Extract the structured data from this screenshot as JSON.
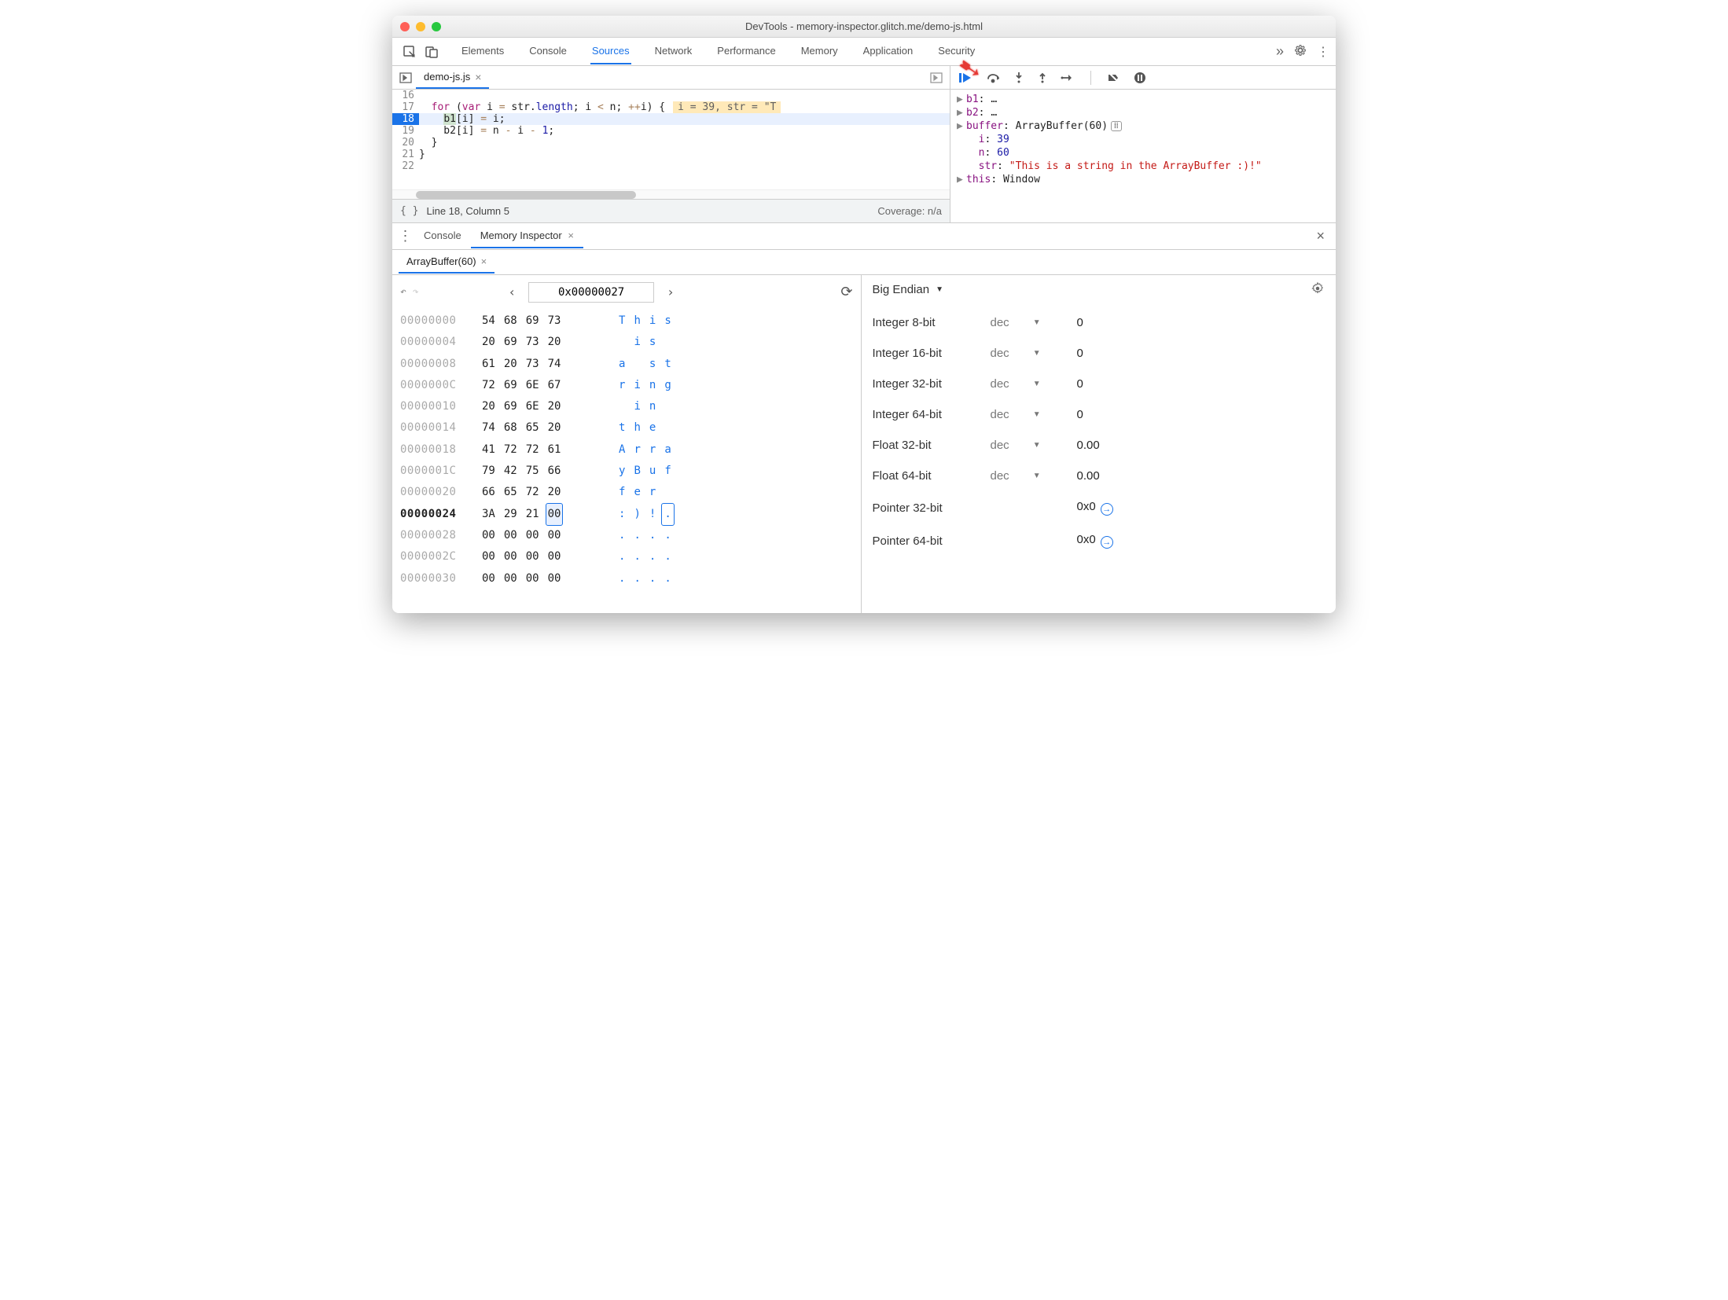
{
  "window": {
    "title": "DevTools - memory-inspector.glitch.me/demo-js.html"
  },
  "main_tabs": [
    "Elements",
    "Console",
    "Sources",
    "Network",
    "Performance",
    "Memory",
    "Application",
    "Security"
  ],
  "main_tabs_active": "Sources",
  "file_tab": "demo-js.js",
  "code": {
    "lines": [
      {
        "n": 16,
        "text": ""
      },
      {
        "n": 17,
        "html": "  <span class='tok-k'>for</span> (<span class='tok-k'>var</span> i <span class='tok-op'>=</span> str.<span class='tok-n'>length</span>; i <span class='tok-op'>&lt;</span> n; <span class='tok-op'>++</span>i) {",
        "hint": "i = 39, str = \"T"
      },
      {
        "n": 18,
        "html": "    <span style='background:#cfe3cf'>b1</span>[i] <span class='tok-op'>=</span> i;",
        "hl": true
      },
      {
        "n": 19,
        "html": "    b2[i] <span class='tok-op'>=</span> n <span class='tok-op'>-</span> i <span class='tok-op'>-</span> <span class='tok-n'>1</span>;"
      },
      {
        "n": 20,
        "html": "  }"
      },
      {
        "n": 21,
        "html": "}"
      },
      {
        "n": 22,
        "html": ""
      }
    ]
  },
  "status": {
    "pos": "Line 18, Column 5",
    "coverage": "Coverage: n/a"
  },
  "scope": [
    {
      "k": "b1",
      "v": "…",
      "exp": true
    },
    {
      "k": "b2",
      "v": "…",
      "exp": true
    },
    {
      "k": "buffer",
      "v": "ArrayBuffer(60)",
      "exp": true,
      "mem": true
    },
    {
      "k": "i",
      "v": "39",
      "num": true,
      "indent": true
    },
    {
      "k": "n",
      "v": "60",
      "num": true,
      "indent": true
    },
    {
      "k": "str",
      "v": "\"This is a string in the ArrayBuffer :)!\"",
      "str": true,
      "indent": true
    },
    {
      "k": "this",
      "v": "Window",
      "exp": true
    }
  ],
  "drawer": {
    "tabs": [
      "Console",
      "Memory Inspector"
    ],
    "active": "Memory Inspector"
  },
  "buffer_tab": "ArrayBuffer(60)",
  "hex": {
    "address": "0x00000027",
    "rows": [
      {
        "a": "00000000",
        "b": [
          "54",
          "68",
          "69",
          "73"
        ],
        "c": [
          "T",
          "h",
          "i",
          "s"
        ]
      },
      {
        "a": "00000004",
        "b": [
          "20",
          "69",
          "73",
          "20"
        ],
        "c": [
          " ",
          "i",
          "s",
          " "
        ]
      },
      {
        "a": "00000008",
        "b": [
          "61",
          "20",
          "73",
          "74"
        ],
        "c": [
          "a",
          " ",
          "s",
          "t"
        ]
      },
      {
        "a": "0000000C",
        "b": [
          "72",
          "69",
          "6E",
          "67"
        ],
        "c": [
          "r",
          "i",
          "n",
          "g"
        ]
      },
      {
        "a": "00000010",
        "b": [
          "20",
          "69",
          "6E",
          "20"
        ],
        "c": [
          " ",
          "i",
          "n",
          " "
        ]
      },
      {
        "a": "00000014",
        "b": [
          "74",
          "68",
          "65",
          "20"
        ],
        "c": [
          "t",
          "h",
          "e",
          " "
        ]
      },
      {
        "a": "00000018",
        "b": [
          "41",
          "72",
          "72",
          "61"
        ],
        "c": [
          "A",
          "r",
          "r",
          "a"
        ]
      },
      {
        "a": "0000001C",
        "b": [
          "79",
          "42",
          "75",
          "66"
        ],
        "c": [
          "y",
          "B",
          "u",
          "f"
        ]
      },
      {
        "a": "00000020",
        "b": [
          "66",
          "65",
          "72",
          "20"
        ],
        "c": [
          "f",
          "e",
          "r",
          " "
        ]
      },
      {
        "a": "00000024",
        "b": [
          "3A",
          "29",
          "21",
          "00"
        ],
        "c": [
          ":",
          ")",
          "!",
          "."
        ],
        "bold": true,
        "sel": 3
      },
      {
        "a": "00000028",
        "b": [
          "00",
          "00",
          "00",
          "00"
        ],
        "c": [
          ".",
          ".",
          ".",
          "."
        ]
      },
      {
        "a": "0000002C",
        "b": [
          "00",
          "00",
          "00",
          "00"
        ],
        "c": [
          ".",
          ".",
          ".",
          "."
        ]
      },
      {
        "a": "00000030",
        "b": [
          "00",
          "00",
          "00",
          "00"
        ],
        "c": [
          ".",
          ".",
          ".",
          "."
        ]
      }
    ]
  },
  "values": {
    "endian": "Big Endian",
    "rows": [
      {
        "label": "Integer 8-bit",
        "mode": "dec",
        "val": "0"
      },
      {
        "label": "Integer 16-bit",
        "mode": "dec",
        "val": "0"
      },
      {
        "label": "Integer 32-bit",
        "mode": "dec",
        "val": "0"
      },
      {
        "label": "Integer 64-bit",
        "mode": "dec",
        "val": "0"
      },
      {
        "label": "Float 32-bit",
        "mode": "dec",
        "val": "0.00"
      },
      {
        "label": "Float 64-bit",
        "mode": "dec",
        "val": "0.00"
      },
      {
        "label": "Pointer 32-bit",
        "mode": "",
        "val": "0x0",
        "jump": true
      },
      {
        "label": "Pointer 64-bit",
        "mode": "",
        "val": "0x0",
        "jump": true
      }
    ]
  }
}
